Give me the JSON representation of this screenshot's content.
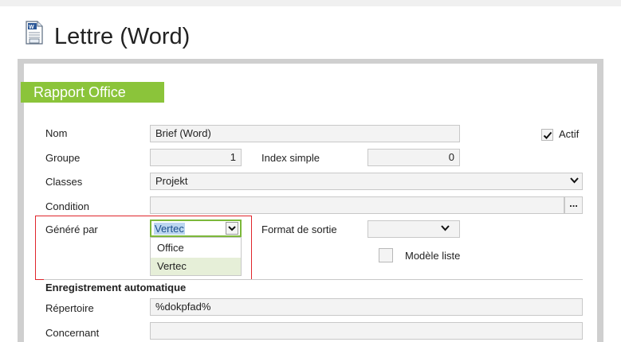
{
  "header": {
    "title": "Lettre (Word)"
  },
  "section": {
    "title": "Rapport Office"
  },
  "form": {
    "nom_label": "Nom",
    "nom_value": "Brief (Word)",
    "actif_label": "Actif",
    "actif_checked": true,
    "groupe_label": "Groupe",
    "groupe_value": "1",
    "index_label": "Index simple",
    "index_value": "0",
    "classes_label": "Classes",
    "classes_value": "Projekt",
    "condition_label": "Condition",
    "condition_value": "",
    "condition_button": "...",
    "genere_label": "Généré par",
    "genere_value": "Vertec",
    "genere_options": [
      "Office",
      "Vertec"
    ],
    "format_label": "Format de sortie",
    "format_value": "",
    "modele_label": "Modèle liste",
    "modele_checked": false,
    "auto_heading": "Enregistrement automatique",
    "repertoire_label": "Répertoire",
    "repertoire_value": "%dokpfad%",
    "concernant_label": "Concernant",
    "concernant_value": ""
  },
  "colors": {
    "accent": "#8bc43a",
    "highlight": "#e0252b",
    "selection": "#bcd6f0"
  },
  "icons": [
    "word-document-icon",
    "chevron-down-icon",
    "checkmark-icon",
    "ellipsis-icon"
  ]
}
